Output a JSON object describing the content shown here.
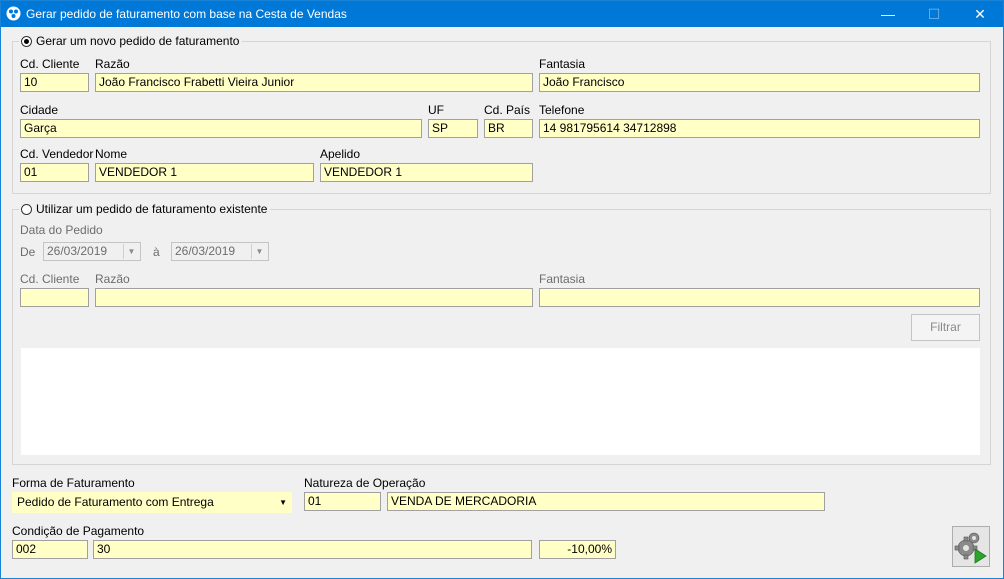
{
  "window": {
    "title": "Gerar pedido de faturamento com base na Cesta de Vendas",
    "minimize": "—",
    "maximize": "☐",
    "close": "✕"
  },
  "new_order": {
    "legend": "Gerar um novo pedido de faturamento",
    "selected": true,
    "labels": {
      "cd_cliente": "Cd. Cliente",
      "razao": "Razão",
      "fantasia": "Fantasia",
      "cidade": "Cidade",
      "uf": "UF",
      "cd_pais": "Cd. País",
      "telefone": "Telefone",
      "cd_vendedor": "Cd. Vendedor",
      "nome": "Nome",
      "apelido": "Apelido"
    },
    "values": {
      "cd_cliente": "10",
      "razao": "João Francisco Frabetti Vieira Junior",
      "fantasia": "João Francisco",
      "cidade": "Garça",
      "uf": "SP",
      "cd_pais": "BR",
      "telefone": "14 981795614 34712898",
      "cd_vendedor": "01",
      "nome": "VENDEDOR 1",
      "apelido": "VENDEDOR 1"
    }
  },
  "existing_order": {
    "legend": "Utilizar um pedido de faturamento existente",
    "selected": false,
    "date_label": "Data do Pedido",
    "from_label": "De",
    "to_label": "à",
    "date_from": "26/03/2019",
    "date_to": "26/03/2019",
    "labels": {
      "cd_cliente": "Cd. Cliente",
      "razao": "Razão",
      "fantasia": "Fantasia"
    },
    "values": {
      "cd_cliente": "",
      "razao": "",
      "fantasia": ""
    },
    "filter_button": "Filtrar"
  },
  "footer": {
    "forma_label": "Forma de Faturamento",
    "forma_value": "Pedido de Faturamento com Entrega",
    "natureza_label": "Natureza de Operação",
    "natureza_code": "01",
    "natureza_desc": "VENDA DE MERCADORIA",
    "condicao_label": "Condição de Pagamento",
    "condicao_code": "002",
    "condicao_desc": "30",
    "desconto": "-10,00%"
  },
  "icons": {
    "app": "app-icon",
    "action": "gears-run-icon"
  },
  "colors": {
    "titlebar": "#0078d7",
    "field_bg": "#ffffc6"
  }
}
